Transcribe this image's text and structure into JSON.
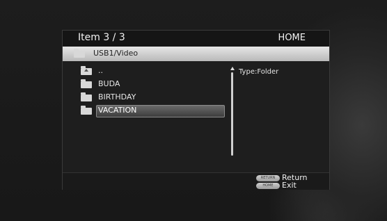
{
  "header": {
    "item_label": "Item  3 / 3",
    "home_label": "HOME"
  },
  "path": {
    "current": "USB1/Video",
    "icon": "folder-icon"
  },
  "list": {
    "items": [
      {
        "label": "..",
        "icon": "folder-up-icon",
        "selected": false
      },
      {
        "label": "BUDA",
        "icon": "folder-icon",
        "selected": false
      },
      {
        "label": "BIRTHDAY",
        "icon": "folder-icon",
        "selected": false
      },
      {
        "label": "VACATION",
        "icon": "folder-icon",
        "selected": true
      }
    ]
  },
  "info": {
    "type_text": "Type:Folder"
  },
  "footer": {
    "return_key": "RETURN",
    "return_label": "Return",
    "home_key": "HOME",
    "exit_label": "Exit"
  }
}
